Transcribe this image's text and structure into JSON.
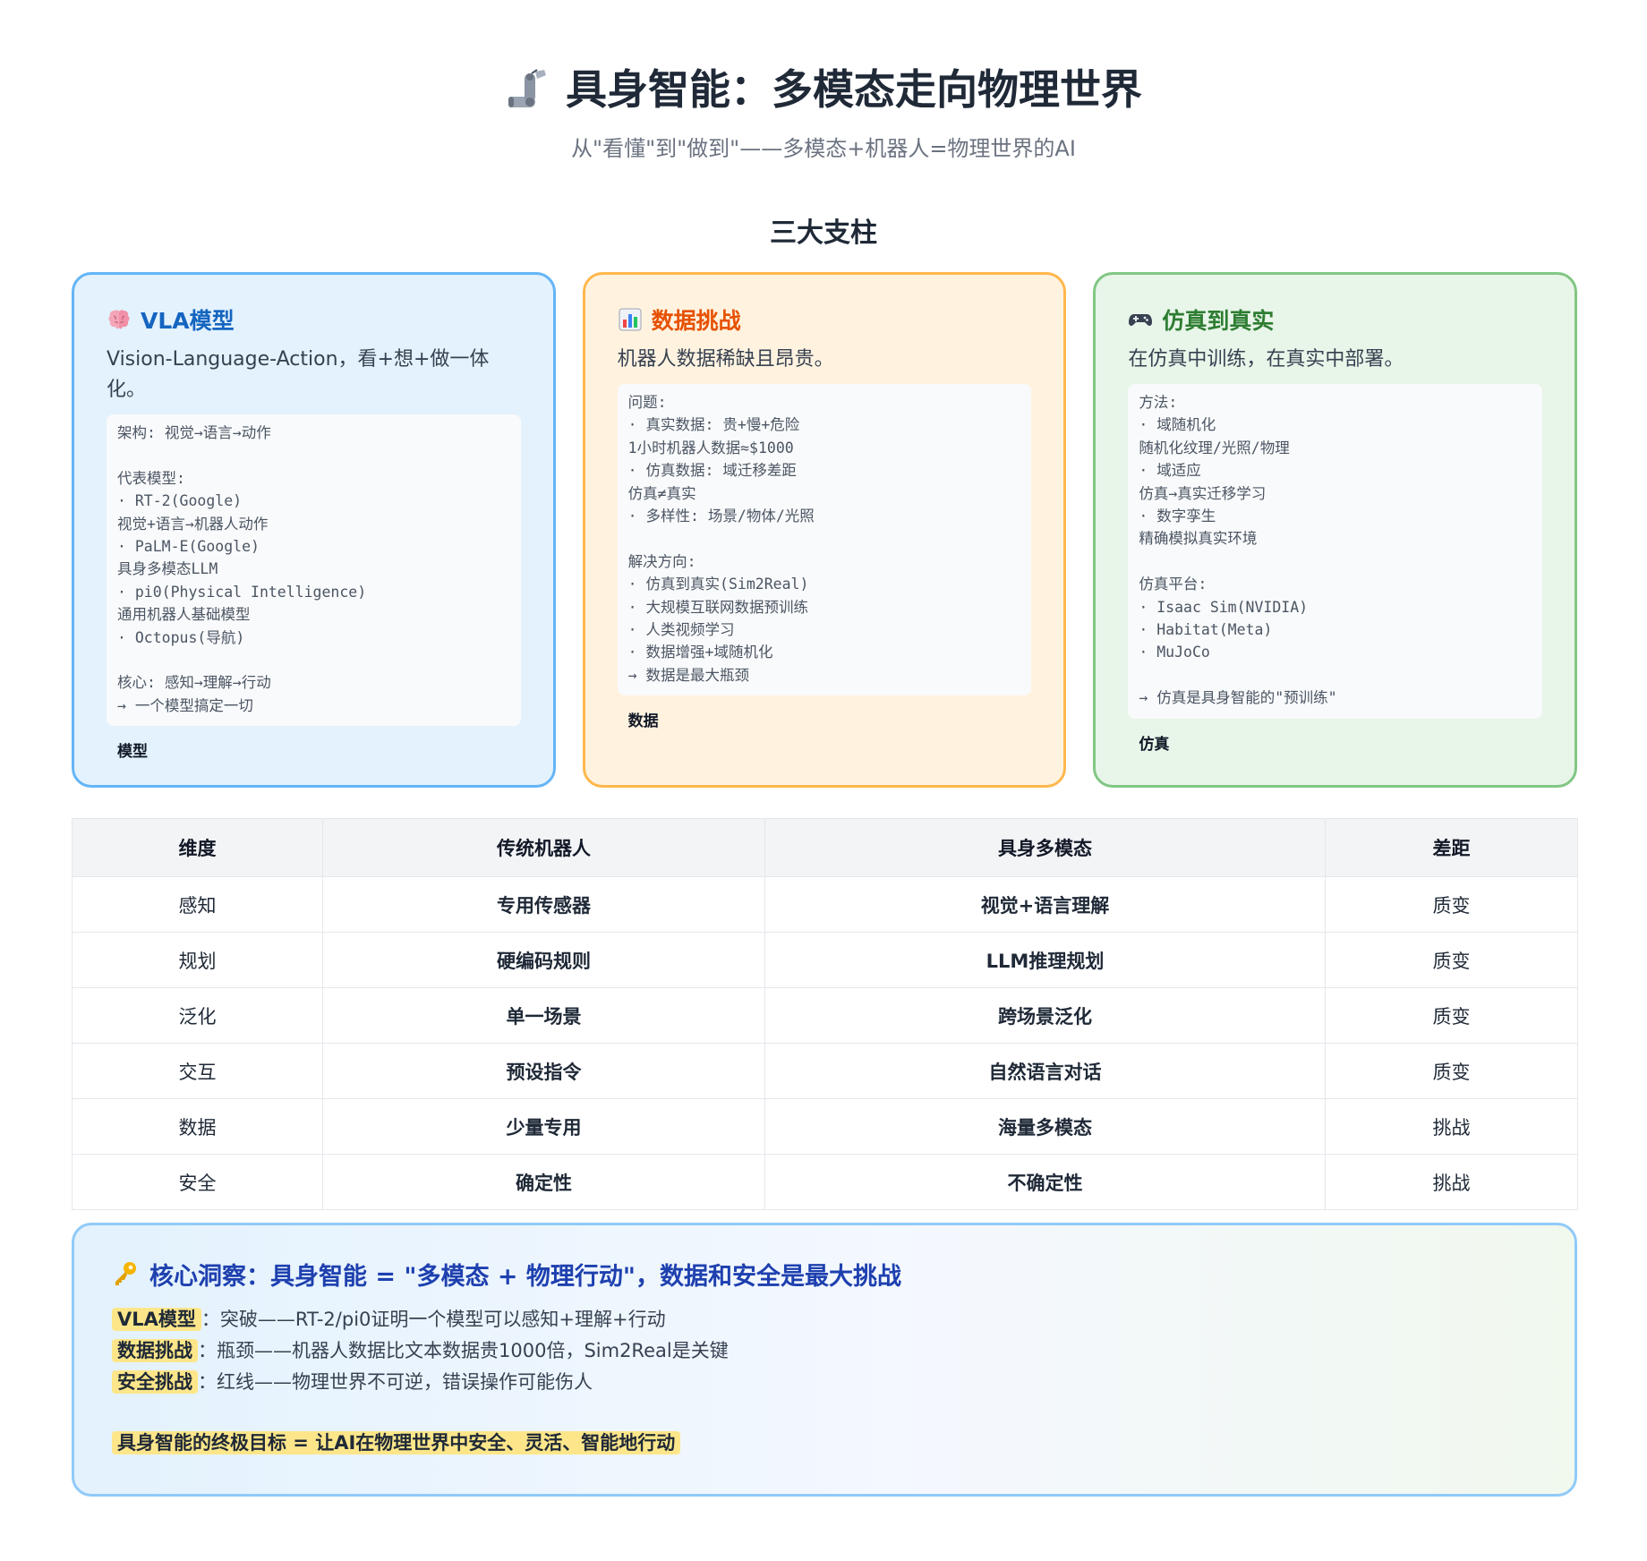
{
  "header": {
    "title": "具身智能：多模态走向物理世界",
    "subtitle": "从\"看懂\"到\"做到\"——多模态+机器人=物理世界的AI"
  },
  "section_title": "三大支柱",
  "cards": [
    {
      "icon": "brain-icon",
      "title": "VLA模型",
      "desc": "Vision-Language-Action，看+想+做一体化。",
      "pre": "架构: 视觉→语言→动作\n\n代表模型:\n· RT-2(Google)\n视觉+语言→机器人动作\n· PaLM-E(Google)\n具身多模态LLM\n· pi0(Physical Intelligence)\n通用机器人基础模型\n· Octopus(导航)\n\n核心: 感知→理解→行动\n→ 一个模型搞定一切",
      "tag": "模型"
    },
    {
      "icon": "bar-chart-icon",
      "title": "数据挑战",
      "desc": "机器人数据稀缺且昂贵。",
      "pre": "问题:\n· 真实数据: 贵+慢+危险\n1小时机器人数据≈$1000\n· 仿真数据: 域迁移差距\n仿真≠真实\n· 多样性: 场景/物体/光照\n\n解决方向:\n· 仿真到真实(Sim2Real)\n· 大规模互联网数据预训练\n· 人类视频学习\n· 数据增强+域随机化\n→ 数据是最大瓶颈",
      "tag": "数据"
    },
    {
      "icon": "gamepad-icon",
      "title": "仿真到真实",
      "desc": "在仿真中训练，在真实中部署。",
      "pre": "方法:\n· 域随机化\n随机化纹理/光照/物理\n· 域适应\n仿真→真实迁移学习\n· 数字孪生\n精确模拟真实环境\n\n仿真平台:\n· Isaac Sim(NVIDIA)\n· Habitat(Meta)\n· MuJoCo\n\n→ 仿真是具身智能的\"预训练\"",
      "tag": "仿真"
    }
  ],
  "table": {
    "headers": [
      "维度",
      "传统机器人",
      "具身多模态",
      "差距"
    ],
    "rows": [
      {
        "dim": "感知",
        "trad": "专用传感器",
        "emb": "视觉+语言理解",
        "gap": "质变"
      },
      {
        "dim": "规划",
        "trad": "硬编码规则",
        "emb": "LLM推理规划",
        "gap": "质变"
      },
      {
        "dim": "泛化",
        "trad": "单一场景",
        "emb": "跨场景泛化",
        "gap": "质变"
      },
      {
        "dim": "交互",
        "trad": "预设指令",
        "emb": "自然语言对话",
        "gap": "质变"
      },
      {
        "dim": "数据",
        "trad": "少量专用",
        "emb": "海量多模态",
        "gap": "挑战"
      },
      {
        "dim": "安全",
        "trad": "确定性",
        "emb": "不确定性",
        "gap": "挑战"
      }
    ],
    "colors": {
      "orange": "#e67e00",
      "red": "#dc2626",
      "green": "#16a34a"
    }
  },
  "insight": {
    "title": "核心洞察：具身智能 = \"多模态 + 物理行动\"，数据和安全是最大挑战",
    "lines": [
      {
        "label": "VLA模型",
        "text": "：突破——RT-2/pi0证明一个模型可以感知+理解+行动"
      },
      {
        "label": "数据挑战",
        "text": "：瓶颈——机器人数据比文本数据贵1000倍，Sim2Real是关键"
      },
      {
        "label": "安全挑战",
        "text": "：红线——物理世界不可逆，错误操作可能伤人"
      }
    ],
    "goal": "具身智能的终极目标 = 让AI在物理世界中安全、灵活、智能地行动"
  }
}
